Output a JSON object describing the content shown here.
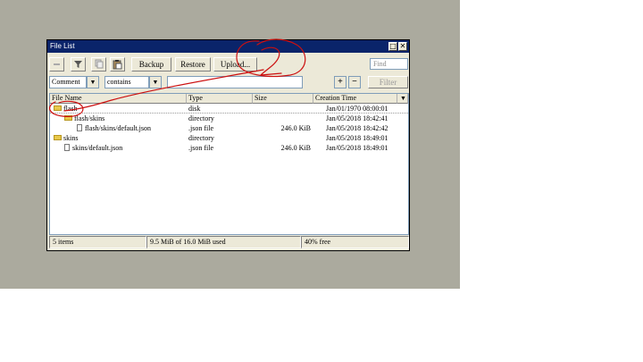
{
  "window": {
    "title": "File List"
  },
  "toolbar": {
    "backup_label": "Backup",
    "restore_label": "Restore",
    "upload_label": "Upload...",
    "find_placeholder": "Find"
  },
  "filter": {
    "field": "Comment",
    "operator": "contains",
    "value": "",
    "add_label": "+",
    "remove_label": "−",
    "filter_label": "Filter"
  },
  "table": {
    "columns": [
      "File Name",
      "Type",
      "Size",
      "Creation Time"
    ],
    "rows": [
      {
        "name": "flash",
        "type": "disk",
        "size": "",
        "time": "Jan/01/1970 08:00:01"
      },
      {
        "name": "flash/skins",
        "type": "directory",
        "size": "",
        "time": "Jan/05/2018 18:42:41"
      },
      {
        "name": "flash/skins/default.json",
        "type": ".json file",
        "size": "246.0 KiB",
        "time": "Jan/05/2018 18:42:42"
      },
      {
        "name": "skins",
        "type": "directory",
        "size": "",
        "time": "Jan/05/2018 18:49:01"
      },
      {
        "name": "skins/default.json",
        "type": ".json file",
        "size": "246.0 KiB",
        "time": "Jan/05/2018 18:49:01"
      }
    ]
  },
  "status": {
    "items": "5 items",
    "usage": "9.5 MiB of 16.0 MiB used",
    "free": "40% free"
  },
  "annotation_color": "#cc1010"
}
